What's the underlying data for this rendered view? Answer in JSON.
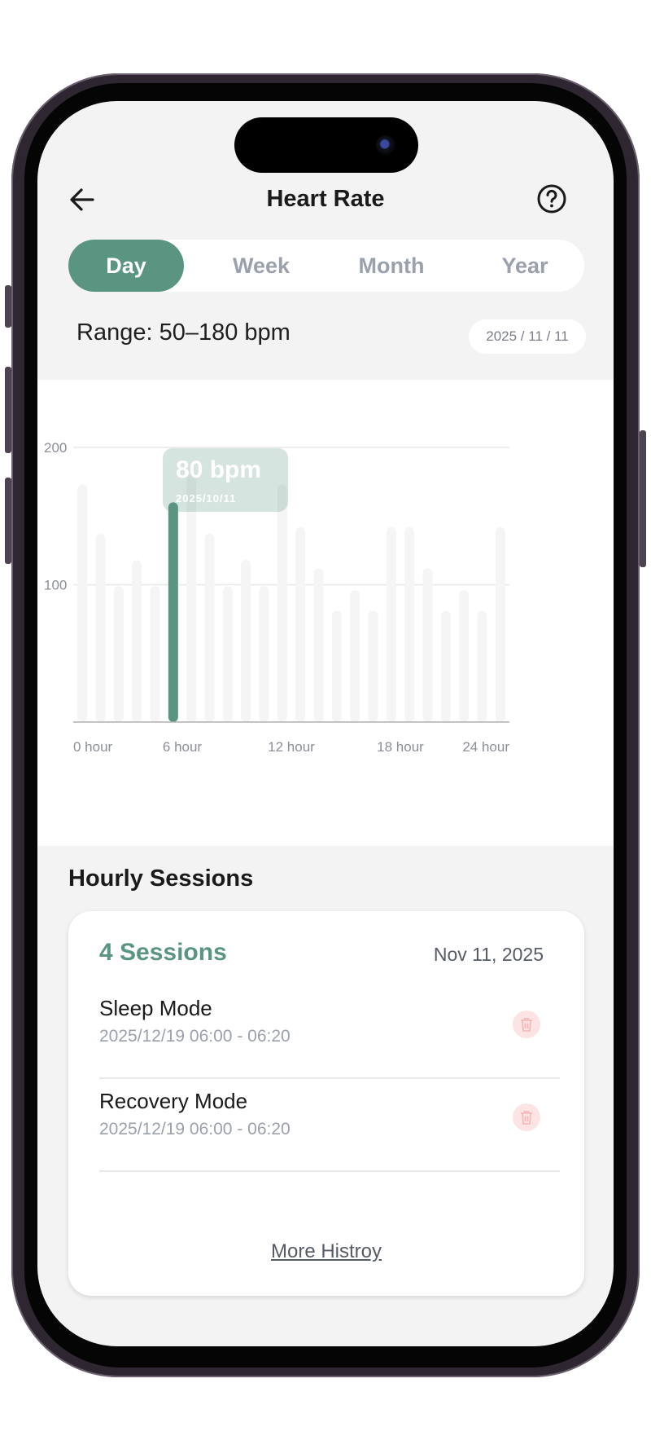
{
  "header": {
    "title": "Heart Rate"
  },
  "tabs": [
    {
      "label": "Day",
      "active": true
    },
    {
      "label": "Week",
      "active": false
    },
    {
      "label": "Month",
      "active": false
    },
    {
      "label": "Year",
      "active": false
    }
  ],
  "range": {
    "label": "Range: 50–180 bpm"
  },
  "date_picker": {
    "value": "2025 / 11 / 11"
  },
  "tooltip": {
    "value": "80 bpm",
    "date": "2025/10/11"
  },
  "chart_data": {
    "type": "bar",
    "x_tick_labels": [
      "0 hour",
      "6 hour",
      "12 hour",
      "18 hour",
      "24 hour"
    ],
    "y_tick_labels": [
      "200",
      "100"
    ],
    "ylim": [
      0,
      200
    ],
    "hours": [
      0,
      1,
      2,
      3,
      4,
      5,
      6,
      7,
      8,
      9,
      10,
      11,
      12,
      13,
      14,
      15,
      16,
      17,
      18,
      19,
      20,
      21,
      22,
      23,
      24
    ],
    "values": [
      173,
      137,
      99,
      118,
      99,
      160,
      180,
      137,
      99,
      118,
      99,
      173,
      142,
      112,
      81,
      96,
      81,
      142,
      142,
      112,
      81,
      96,
      81,
      142
    ],
    "highlight_index": 5,
    "grid": true,
    "colors": {
      "highlight": "#5a9582",
      "bar": "#f5f5f5",
      "grid": "#e8e8e8",
      "axis": "#b0b0b0"
    }
  },
  "sessions": {
    "title": "Hourly Sessions",
    "count_label": "4 Sessions",
    "date": "Nov 11, 2025",
    "items": [
      {
        "name": "Sleep Mode",
        "time": "2025/12/19 06:00 - 06:20"
      },
      {
        "name": "Recovery Mode",
        "time": "2025/12/19 06:00 - 06:20"
      }
    ],
    "more_label": "More Histroy"
  },
  "icons": {
    "back": "arrow-left-icon",
    "help": "question-circle-icon",
    "delete": "trash-icon"
  },
  "colors": {
    "accent": "#5a9582",
    "background": "#f2f3f2",
    "danger_soft": "#fce4e4"
  }
}
